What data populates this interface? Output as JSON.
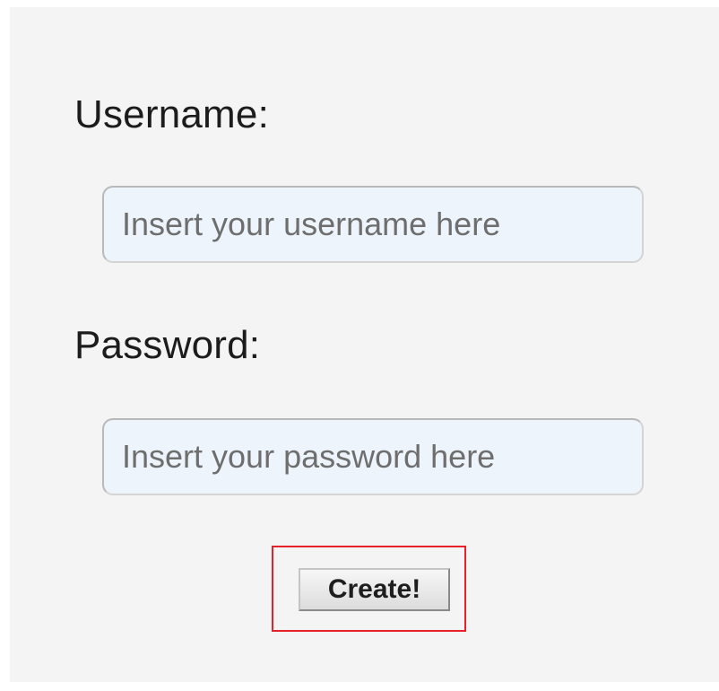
{
  "form": {
    "username_label": "Username:",
    "username_placeholder": "Insert your username here",
    "password_label": "Password:",
    "password_placeholder": "Insert your password here",
    "submit_label": "Create!"
  },
  "colors": {
    "panel_background": "#f4f4f4",
    "input_background": "#eef4fb",
    "highlight_border": "#e8202a"
  }
}
